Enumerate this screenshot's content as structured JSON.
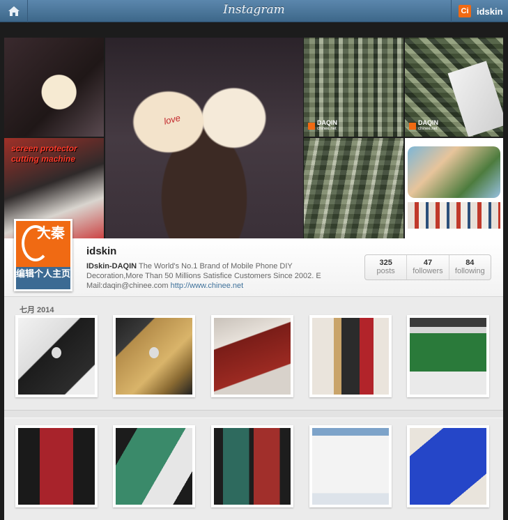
{
  "header": {
    "brand": "Instagram",
    "username": "idskin",
    "logo_glyph": "Ci"
  },
  "mosaic": {
    "overlay_text": "screen protector cutting machine",
    "phone_text": "love",
    "watermark": "DAQIN",
    "watermark_url": "chinee.net"
  },
  "profile": {
    "username": "idskin",
    "avatar_chars": "大秦",
    "edit_button": "编辑个人主页",
    "bio_name": "IDskin-DAQIN",
    "bio_text": "The World's No.1 Brand of Mobile Phone DIY Decoration,More Than 50 Millions Satisfice Customers Since 2002. E Mail:daqin@chinee.com",
    "website": "http://www.chinee.net",
    "stats": [
      {
        "count": "325",
        "label": "posts"
      },
      {
        "count": "47",
        "label": "followers"
      },
      {
        "count": "84",
        "label": "following"
      }
    ]
  },
  "feed": {
    "month_label": "七月 2014"
  },
  "colors": {
    "accent": "#f06a13",
    "header_blue": "#4a769a",
    "link": "#3f729b"
  }
}
